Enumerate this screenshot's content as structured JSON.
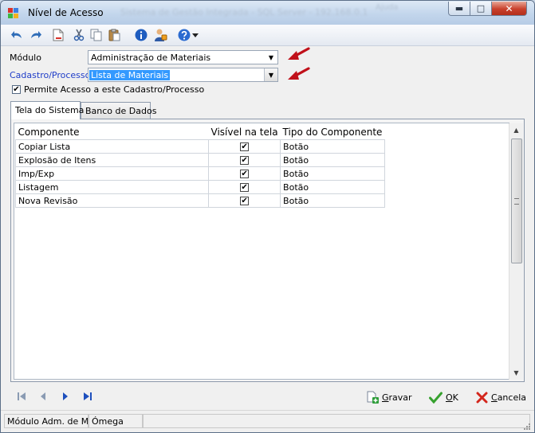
{
  "window": {
    "title": "Nível de Acesso",
    "background_blur_text": "Sistema de Gestão Integrada - SQL Server - 192.168.0.1",
    "background_blur_text2": "Ajuda",
    "minimize": "▬",
    "maximize": "□",
    "close": "✕"
  },
  "form": {
    "modulo_label": "Módulo",
    "modulo_value": "Administração de Materiais",
    "cadastro_label": "Cadastro/Processo",
    "cadastro_value": "Lista de Materiais",
    "permite_label": "Permite Acesso a este Cadastro/Processo",
    "permite_checked": true
  },
  "tabs": [
    {
      "label": "Tela do Sistema",
      "active": true
    },
    {
      "label": "Banco de Dados",
      "active": false
    }
  ],
  "grid": {
    "headers": [
      "Componente",
      "Visível na tela",
      "Tipo do Componente"
    ],
    "rows": [
      {
        "componente": "Copiar Lista",
        "visivel": true,
        "tipo": "Botão"
      },
      {
        "componente": "Explosão de Itens",
        "visivel": true,
        "tipo": "Botão"
      },
      {
        "componente": "Imp/Exp",
        "visivel": true,
        "tipo": "Botão"
      },
      {
        "componente": "Listagem",
        "visivel": true,
        "tipo": "Botão"
      },
      {
        "componente": "Nova Revisão",
        "visivel": true,
        "tipo": "Botão"
      }
    ]
  },
  "actions": {
    "gravar": "Gravar",
    "ok": "OK",
    "cancela": "Cancela"
  },
  "status": {
    "panel1": "Módulo Adm. de Materiais",
    "panel2": "Ómega",
    "panel3": ""
  },
  "colors": {
    "accent_blue": "#1f3dc8",
    "selection": "#3399ff",
    "arrow_red": "#c0111a"
  }
}
